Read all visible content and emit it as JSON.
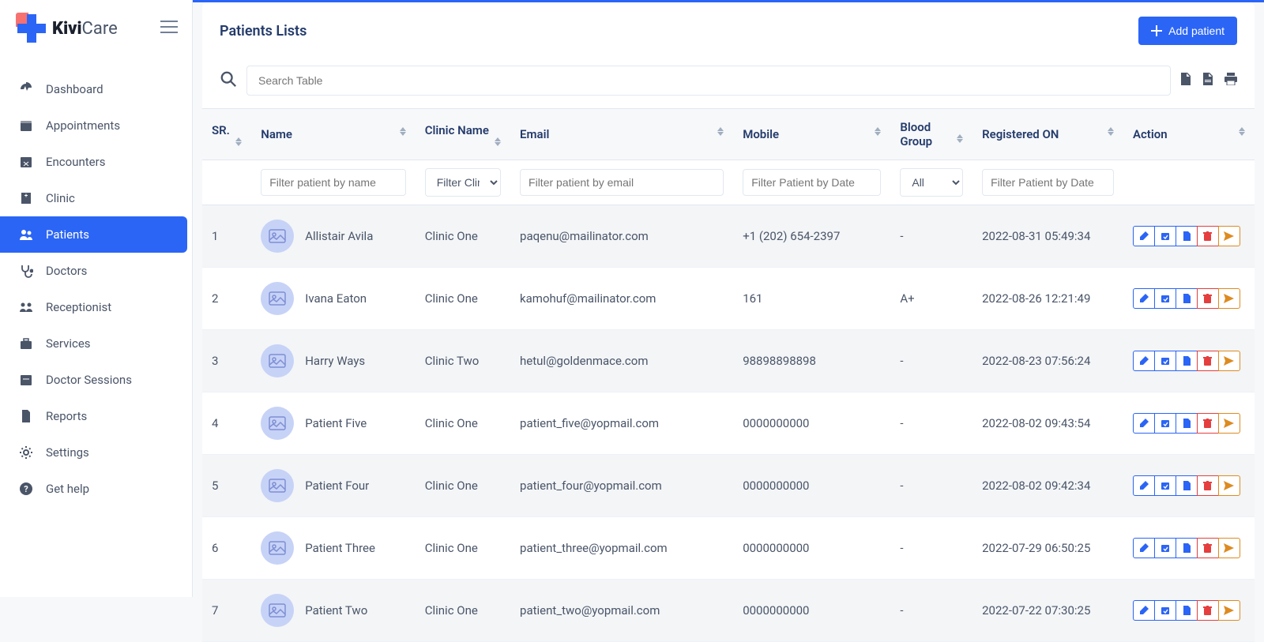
{
  "brand": {
    "name": "KiviCare",
    "bold": "Kivi",
    "light": "Care"
  },
  "sidebar": {
    "items": [
      {
        "label": "Dashboard",
        "icon": "gauge"
      },
      {
        "label": "Appointments",
        "icon": "calendar"
      },
      {
        "label": "Encounters",
        "icon": "calendar-x"
      },
      {
        "label": "Clinic",
        "icon": "hospital"
      },
      {
        "label": "Patients",
        "icon": "users",
        "active": true
      },
      {
        "label": "Doctors",
        "icon": "stethoscope"
      },
      {
        "label": "Receptionist",
        "icon": "group"
      },
      {
        "label": "Services",
        "icon": "briefcase"
      },
      {
        "label": "Doctor Sessions",
        "icon": "clock"
      },
      {
        "label": "Reports",
        "icon": "file"
      },
      {
        "label": "Settings",
        "icon": "cog"
      },
      {
        "label": "Get help",
        "icon": "help"
      }
    ]
  },
  "page": {
    "title": "Patients Lists",
    "add_button": "Add patient",
    "search_placeholder": "Search Table"
  },
  "table": {
    "headers": {
      "sr": "SR.",
      "name": "Name",
      "clinic": "Clinic Name",
      "email": "Email",
      "mobile": "Mobile",
      "blood": "Blood Group",
      "registered": "Registered ON",
      "action": "Action"
    },
    "filters": {
      "name": "Filter patient by name",
      "clinic": "Filter Clinic",
      "email": "Filter patient by email",
      "mobile": "Filter Patient by Date",
      "blood": "All",
      "registered": "Filter Patient by Date"
    },
    "rows": [
      {
        "sr": "1",
        "name": "Allistair Avila",
        "clinic": "Clinic One",
        "email": "paqenu@mailinator.com",
        "mobile": "+1 (202) 654-2397",
        "blood": "-",
        "registered": "2022-08-31 05:49:34"
      },
      {
        "sr": "2",
        "name": "Ivana Eaton",
        "clinic": "Clinic One",
        "email": "kamohuf@mailinator.com",
        "mobile": "161",
        "blood": "A+",
        "registered": "2022-08-26 12:21:49"
      },
      {
        "sr": "3",
        "name": "Harry Ways",
        "clinic": "Clinic Two",
        "email": "hetul@goldenmace.com",
        "mobile": "98898898898",
        "blood": "-",
        "registered": "2022-08-23 07:56:24"
      },
      {
        "sr": "4",
        "name": "Patient Five",
        "clinic": "Clinic One",
        "email": "patient_five@yopmail.com",
        "mobile": "0000000000",
        "blood": "-",
        "registered": "2022-08-02 09:43:54"
      },
      {
        "sr": "5",
        "name": "Patient Four",
        "clinic": "Clinic One",
        "email": "patient_four@yopmail.com",
        "mobile": "0000000000",
        "blood": "-",
        "registered": "2022-08-02 09:42:34"
      },
      {
        "sr": "6",
        "name": "Patient Three",
        "clinic": "Clinic One",
        "email": "patient_three@yopmail.com",
        "mobile": "0000000000",
        "blood": "-",
        "registered": "2022-07-29 06:50:25"
      },
      {
        "sr": "7",
        "name": "Patient Two",
        "clinic": "Clinic One",
        "email": "patient_two@yopmail.com",
        "mobile": "0000000000",
        "blood": "-",
        "registered": "2022-07-22 07:30:25"
      }
    ]
  }
}
